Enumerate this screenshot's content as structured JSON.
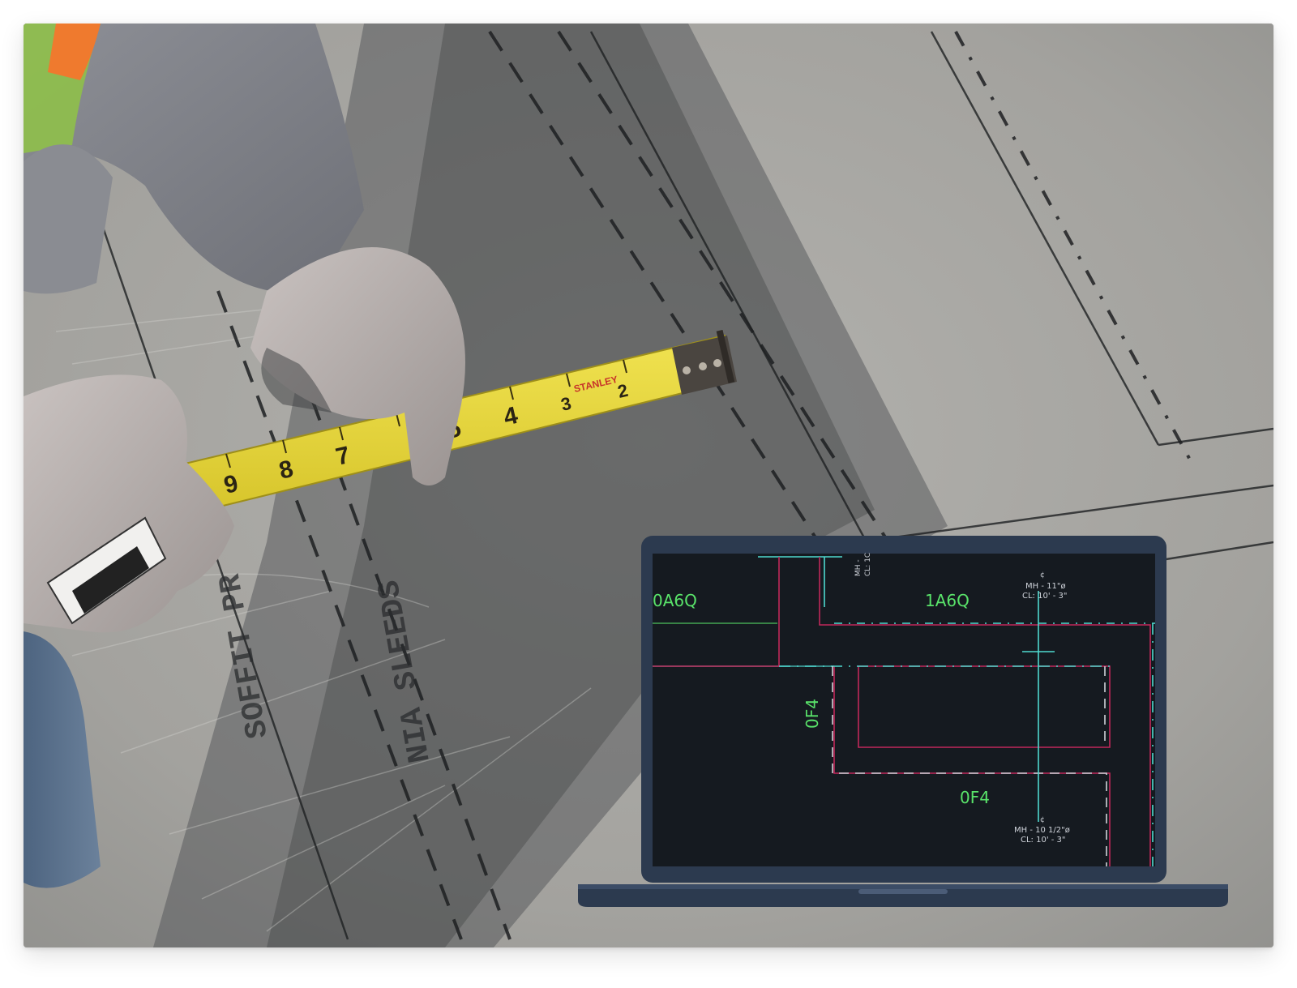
{
  "photo": {
    "description_icons": [
      "measuring-tape-icon",
      "laptop-icon",
      "glove-icon"
    ]
  },
  "tape": {
    "brand": "STANLEY",
    "numerals": [
      "2",
      "3",
      "4",
      "5",
      "7",
      "8",
      "9"
    ]
  },
  "floor": {
    "marking_1": "SOFFIT PR",
    "marking_2": "NIA SLEEDS"
  },
  "cad": {
    "label_top_left": "0A6Q",
    "label_top_right": "1A6Q",
    "label_vertical": "0F4",
    "label_bottom": "0F4",
    "note_top_symbol": "¢",
    "note_top_line1": "MH - 11\"ø",
    "note_top_line2": "CL: 10' - 3\"",
    "note_bottom_symbol": "¢",
    "note_bottom_line1": "MH - 10 1/2\"ø",
    "note_bottom_line2": "CL: 10' - 3\"",
    "note_edge_line1": "MH -",
    "note_edge_line2": "CL: 1C"
  },
  "colors": {
    "screen_bg": "#151a20",
    "laptop_frame": "#2c3a4f",
    "cad_green": "#59e36a",
    "cad_magenta": "#c0285a",
    "cad_cyan": "#4fd9d0",
    "tape_yellow": "#e8d83a"
  }
}
